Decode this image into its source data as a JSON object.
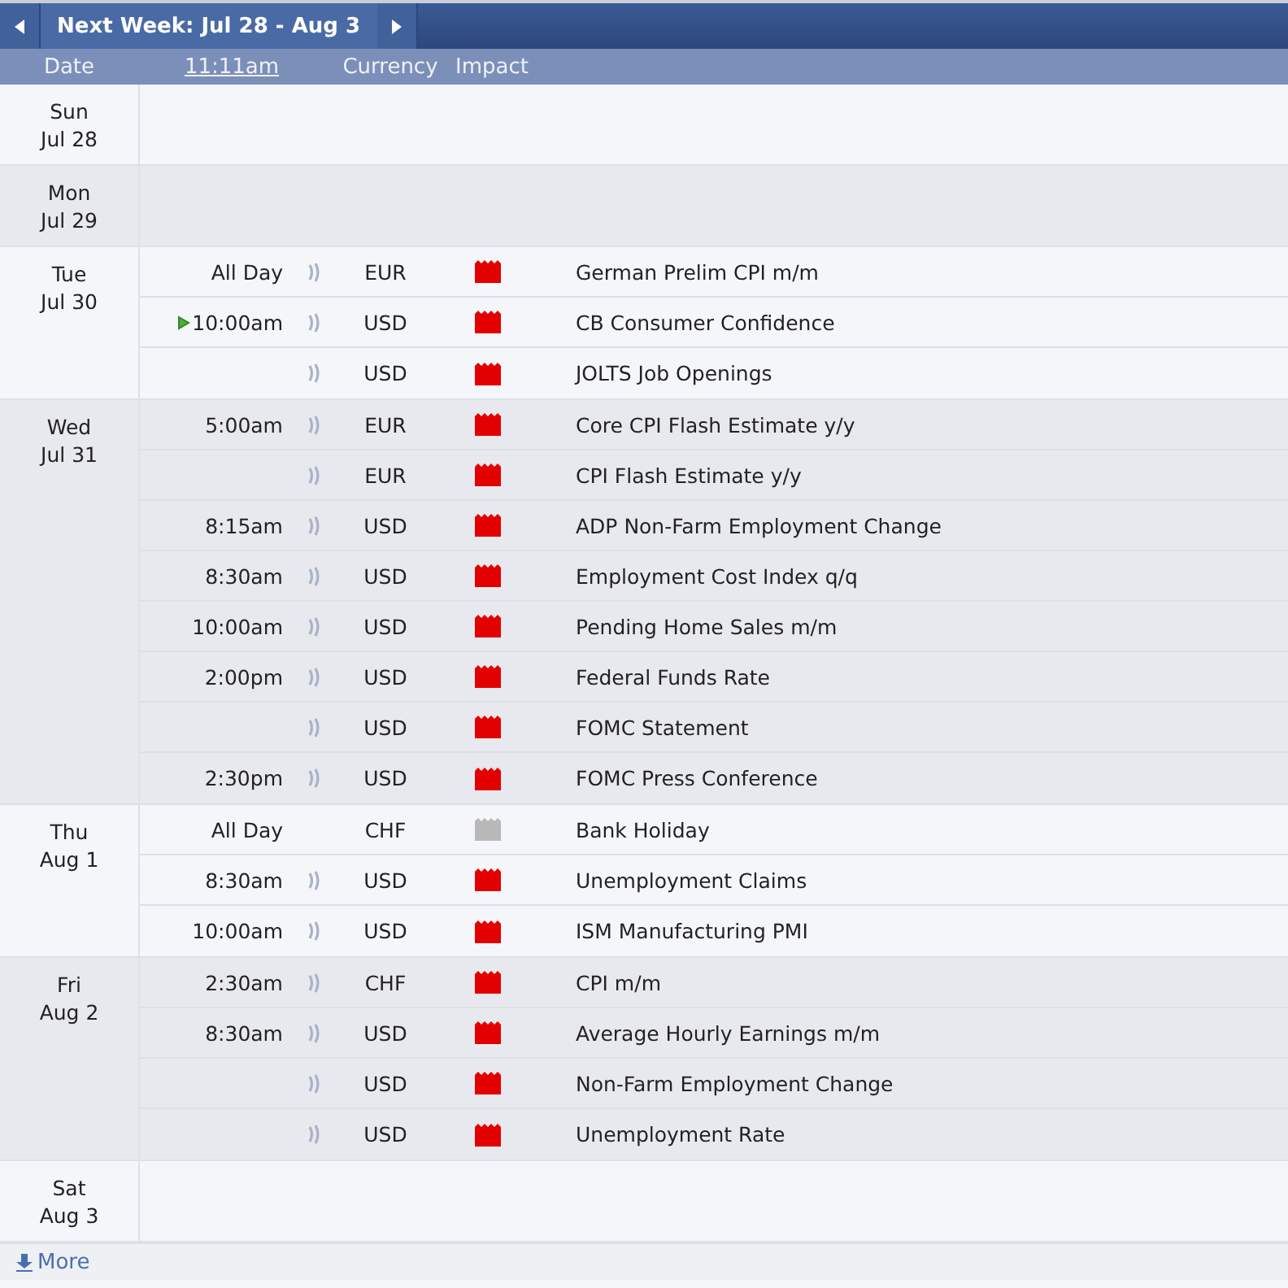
{
  "header": {
    "title": "Next Week: Jul 28 - Aug 3"
  },
  "columns": {
    "date": "Date",
    "time": "11:11am",
    "currency": "Currency",
    "impact": "Impact"
  },
  "days": [
    {
      "day": "Sun",
      "date": "Jul 28"
    },
    {
      "day": "Mon",
      "date": "Jul 29"
    },
    {
      "day": "Tue",
      "date": "Jul 30",
      "events": [
        {
          "time": "All Day",
          "next": false,
          "alert": true,
          "currency": "EUR",
          "color": "#e30000",
          "title": "German Prelim CPI m/m"
        },
        {
          "time": "10:00am",
          "next": true,
          "alert": true,
          "currency": "USD",
          "color": "#e30000",
          "title": "CB Consumer Confidence"
        },
        {
          "next": false,
          "alert": true,
          "currency": "USD",
          "color": "#e30000",
          "title": "JOLTS Job Openings"
        }
      ]
    },
    {
      "day": "Wed",
      "date": "Jul 31",
      "events": [
        {
          "time": "5:00am",
          "next": false,
          "alert": true,
          "currency": "EUR",
          "color": "#e30000",
          "title": "Core CPI Flash Estimate y/y"
        },
        {
          "next": false,
          "alert": true,
          "currency": "EUR",
          "color": "#e30000",
          "title": "CPI Flash Estimate y/y"
        },
        {
          "time": "8:15am",
          "next": false,
          "alert": true,
          "currency": "USD",
          "color": "#e30000",
          "title": "ADP Non-Farm Employment Change"
        },
        {
          "time": "8:30am",
          "next": false,
          "alert": true,
          "currency": "USD",
          "color": "#e30000",
          "title": "Employment Cost Index q/q"
        },
        {
          "time": "10:00am",
          "next": false,
          "alert": true,
          "currency": "USD",
          "color": "#e30000",
          "title": "Pending Home Sales m/m"
        },
        {
          "time": "2:00pm",
          "next": false,
          "alert": true,
          "currency": "USD",
          "color": "#e30000",
          "title": "Federal Funds Rate"
        },
        {
          "next": false,
          "alert": true,
          "currency": "USD",
          "color": "#e30000",
          "title": "FOMC Statement"
        },
        {
          "time": "2:30pm",
          "next": false,
          "alert": true,
          "currency": "USD",
          "color": "#e30000",
          "title": "FOMC Press Conference"
        }
      ]
    },
    {
      "day": "Thu",
      "date": "Aug 1",
      "events": [
        {
          "time": "All Day",
          "next": false,
          "alert": false,
          "currency": "CHF",
          "color": "#b8b8b8",
          "title": "Bank Holiday"
        },
        {
          "time": "8:30am",
          "next": false,
          "alert": true,
          "currency": "USD",
          "color": "#e30000",
          "title": "Unemployment Claims"
        },
        {
          "time": "10:00am",
          "next": false,
          "alert": true,
          "currency": "USD",
          "color": "#e30000",
          "title": "ISM Manufacturing PMI"
        }
      ]
    },
    {
      "day": "Fri",
      "date": "Aug 2",
      "events": [
        {
          "time": "2:30am",
          "next": false,
          "alert": true,
          "currency": "CHF",
          "color": "#e30000",
          "title": "CPI m/m"
        },
        {
          "time": "8:30am",
          "next": false,
          "alert": true,
          "currency": "USD",
          "color": "#e30000",
          "title": "Average Hourly Earnings m/m"
        },
        {
          "next": false,
          "alert": true,
          "currency": "USD",
          "color": "#e30000",
          "title": "Non-Farm Employment Change"
        },
        {
          "next": false,
          "alert": true,
          "currency": "USD",
          "color": "#e30000",
          "title": "Unemployment Rate"
        }
      ]
    },
    {
      "day": "Sat",
      "date": "Aug 3"
    }
  ],
  "footer": {
    "more": "More"
  }
}
